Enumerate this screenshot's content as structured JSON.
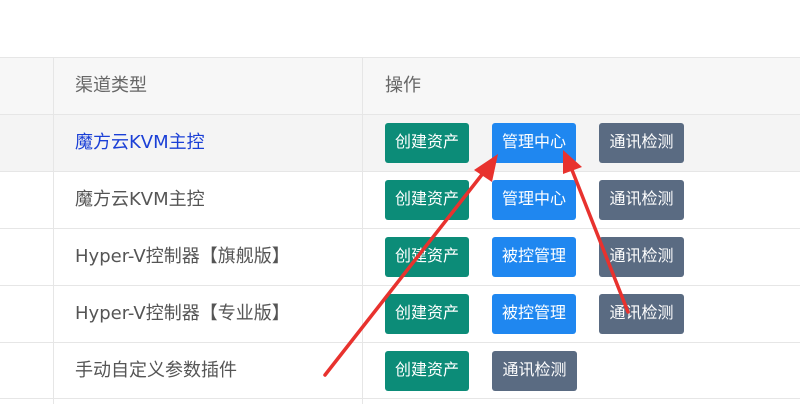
{
  "table": {
    "headers": {
      "channel_type": "渠道类型",
      "actions": "操作"
    },
    "rows": [
      {
        "channel": "魔方云KVM主控",
        "buttons": [
          "创建资产",
          "管理中心",
          "通讯检测"
        ]
      },
      {
        "channel": "魔方云KVM主控",
        "buttons": [
          "创建资产",
          "管理中心",
          "通讯检测"
        ]
      },
      {
        "channel": "Hyper-V控制器【旗舰版】",
        "buttons": [
          "创建资产",
          "被控管理",
          "通讯检测"
        ]
      },
      {
        "channel": "Hyper-V控制器【专业版】",
        "buttons": [
          "创建资产",
          "被控管理",
          "通讯检测"
        ]
      },
      {
        "channel": "手动自定义参数插件",
        "buttons": [
          "创建资产",
          "通讯检测"
        ]
      }
    ]
  },
  "colors": {
    "create_button": "#0c8c78",
    "manage_button": "#1f87f0",
    "test_button": "#5a6b82",
    "annotation_arrow": "#e8322e",
    "link_text": "#1a3fd6"
  }
}
